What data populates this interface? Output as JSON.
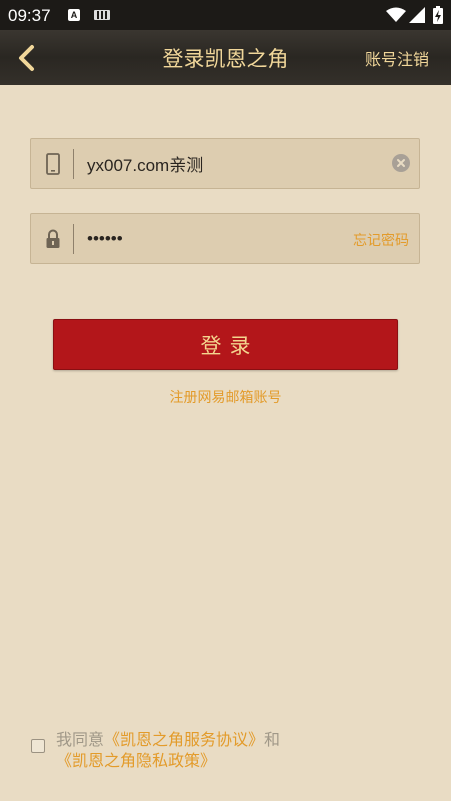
{
  "status_bar": {
    "time": "09:37",
    "indicator_a": "A"
  },
  "header": {
    "back_icon": "chevron-left-icon",
    "title": "登录凯恩之角",
    "right_link": "账号注销"
  },
  "form": {
    "account": {
      "icon": "phone-icon",
      "value": "yx007.com亲测",
      "clear_icon": "clear-icon"
    },
    "password": {
      "icon": "lock-icon",
      "value": "••••••",
      "forgot_label": "忘记密码"
    },
    "login_label": "登录",
    "register_label": "注册网易邮箱账号"
  },
  "agreement": {
    "prefix": "我同意",
    "terms_link": "《凯恩之角服务协议》",
    "conjunction": "和",
    "privacy_link": "《凯恩之角隐私政策》",
    "checked": false
  },
  "colors": {
    "background": "#e9dcc4",
    "accent": "#e39b2a",
    "primary_button": "#b3161a",
    "header_text": "#f1d79a"
  }
}
